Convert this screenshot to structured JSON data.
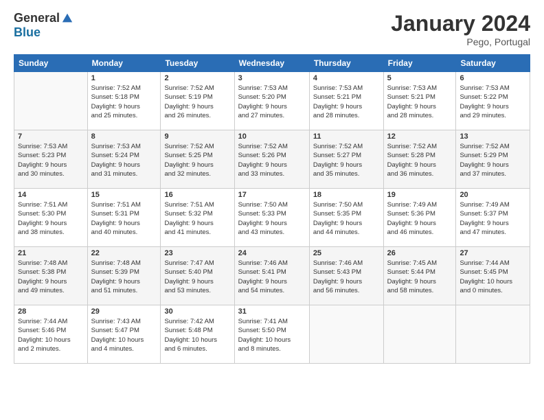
{
  "header": {
    "logo_general": "General",
    "logo_blue": "Blue",
    "month_title": "January 2024",
    "location": "Pego, Portugal"
  },
  "columns": [
    "Sunday",
    "Monday",
    "Tuesday",
    "Wednesday",
    "Thursday",
    "Friday",
    "Saturday"
  ],
  "weeks": [
    {
      "days": [
        {
          "num": "",
          "info": ""
        },
        {
          "num": "1",
          "info": "Sunrise: 7:52 AM\nSunset: 5:18 PM\nDaylight: 9 hours\nand 25 minutes."
        },
        {
          "num": "2",
          "info": "Sunrise: 7:52 AM\nSunset: 5:19 PM\nDaylight: 9 hours\nand 26 minutes."
        },
        {
          "num": "3",
          "info": "Sunrise: 7:53 AM\nSunset: 5:20 PM\nDaylight: 9 hours\nand 27 minutes."
        },
        {
          "num": "4",
          "info": "Sunrise: 7:53 AM\nSunset: 5:21 PM\nDaylight: 9 hours\nand 28 minutes."
        },
        {
          "num": "5",
          "info": "Sunrise: 7:53 AM\nSunset: 5:21 PM\nDaylight: 9 hours\nand 28 minutes."
        },
        {
          "num": "6",
          "info": "Sunrise: 7:53 AM\nSunset: 5:22 PM\nDaylight: 9 hours\nand 29 minutes."
        }
      ]
    },
    {
      "days": [
        {
          "num": "7",
          "info": "Sunrise: 7:53 AM\nSunset: 5:23 PM\nDaylight: 9 hours\nand 30 minutes."
        },
        {
          "num": "8",
          "info": "Sunrise: 7:53 AM\nSunset: 5:24 PM\nDaylight: 9 hours\nand 31 minutes."
        },
        {
          "num": "9",
          "info": "Sunrise: 7:52 AM\nSunset: 5:25 PM\nDaylight: 9 hours\nand 32 minutes."
        },
        {
          "num": "10",
          "info": "Sunrise: 7:52 AM\nSunset: 5:26 PM\nDaylight: 9 hours\nand 33 minutes."
        },
        {
          "num": "11",
          "info": "Sunrise: 7:52 AM\nSunset: 5:27 PM\nDaylight: 9 hours\nand 35 minutes."
        },
        {
          "num": "12",
          "info": "Sunrise: 7:52 AM\nSunset: 5:28 PM\nDaylight: 9 hours\nand 36 minutes."
        },
        {
          "num": "13",
          "info": "Sunrise: 7:52 AM\nSunset: 5:29 PM\nDaylight: 9 hours\nand 37 minutes."
        }
      ]
    },
    {
      "days": [
        {
          "num": "14",
          "info": "Sunrise: 7:51 AM\nSunset: 5:30 PM\nDaylight: 9 hours\nand 38 minutes."
        },
        {
          "num": "15",
          "info": "Sunrise: 7:51 AM\nSunset: 5:31 PM\nDaylight: 9 hours\nand 40 minutes."
        },
        {
          "num": "16",
          "info": "Sunrise: 7:51 AM\nSunset: 5:32 PM\nDaylight: 9 hours\nand 41 minutes."
        },
        {
          "num": "17",
          "info": "Sunrise: 7:50 AM\nSunset: 5:33 PM\nDaylight: 9 hours\nand 43 minutes."
        },
        {
          "num": "18",
          "info": "Sunrise: 7:50 AM\nSunset: 5:35 PM\nDaylight: 9 hours\nand 44 minutes."
        },
        {
          "num": "19",
          "info": "Sunrise: 7:49 AM\nSunset: 5:36 PM\nDaylight: 9 hours\nand 46 minutes."
        },
        {
          "num": "20",
          "info": "Sunrise: 7:49 AM\nSunset: 5:37 PM\nDaylight: 9 hours\nand 47 minutes."
        }
      ]
    },
    {
      "days": [
        {
          "num": "21",
          "info": "Sunrise: 7:48 AM\nSunset: 5:38 PM\nDaylight: 9 hours\nand 49 minutes."
        },
        {
          "num": "22",
          "info": "Sunrise: 7:48 AM\nSunset: 5:39 PM\nDaylight: 9 hours\nand 51 minutes."
        },
        {
          "num": "23",
          "info": "Sunrise: 7:47 AM\nSunset: 5:40 PM\nDaylight: 9 hours\nand 53 minutes."
        },
        {
          "num": "24",
          "info": "Sunrise: 7:46 AM\nSunset: 5:41 PM\nDaylight: 9 hours\nand 54 minutes."
        },
        {
          "num": "25",
          "info": "Sunrise: 7:46 AM\nSunset: 5:43 PM\nDaylight: 9 hours\nand 56 minutes."
        },
        {
          "num": "26",
          "info": "Sunrise: 7:45 AM\nSunset: 5:44 PM\nDaylight: 9 hours\nand 58 minutes."
        },
        {
          "num": "27",
          "info": "Sunrise: 7:44 AM\nSunset: 5:45 PM\nDaylight: 10 hours\nand 0 minutes."
        }
      ]
    },
    {
      "days": [
        {
          "num": "28",
          "info": "Sunrise: 7:44 AM\nSunset: 5:46 PM\nDaylight: 10 hours\nand 2 minutes."
        },
        {
          "num": "29",
          "info": "Sunrise: 7:43 AM\nSunset: 5:47 PM\nDaylight: 10 hours\nand 4 minutes."
        },
        {
          "num": "30",
          "info": "Sunrise: 7:42 AM\nSunset: 5:48 PM\nDaylight: 10 hours\nand 6 minutes."
        },
        {
          "num": "31",
          "info": "Sunrise: 7:41 AM\nSunset: 5:50 PM\nDaylight: 10 hours\nand 8 minutes."
        },
        {
          "num": "",
          "info": ""
        },
        {
          "num": "",
          "info": ""
        },
        {
          "num": "",
          "info": ""
        }
      ]
    }
  ]
}
